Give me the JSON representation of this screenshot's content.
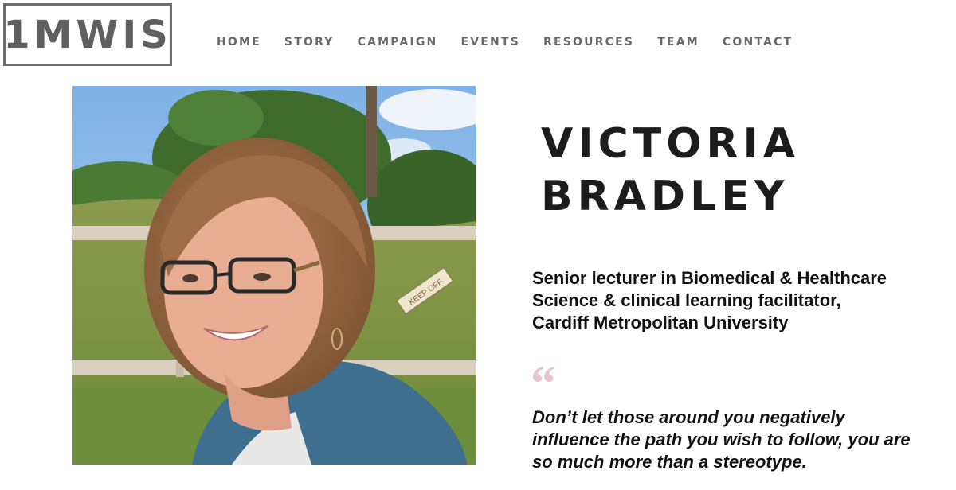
{
  "logo": {
    "text": "1MWIS"
  },
  "nav": {
    "items": [
      "HOME",
      "STORY",
      "CAMPAIGN",
      "EVENTS",
      "RESOURCES",
      "TEAM",
      "CONTACT"
    ]
  },
  "profile": {
    "name_line1": "VICTORIA",
    "name_line2": "BRADLEY",
    "role_line1": "Senior lecturer in Biomedical & Healthcare",
    "role_line2": "Science & clinical learning facilitator,",
    "role_line3": "Cardiff Metropolitan University",
    "quote_mark": "“",
    "quote_line1": "Don’t let those around you negatively",
    "quote_line2": "influence the path you wish to follow, you are",
    "quote_line3": "so much more than a stereotype.",
    "photo_sign_text": "KEEP OFF"
  },
  "colors": {
    "logo": "#5f5f5f",
    "nav": "#6a6a6a",
    "heading": "#1c1c1c",
    "quote_mark": "#e6c6cc"
  }
}
